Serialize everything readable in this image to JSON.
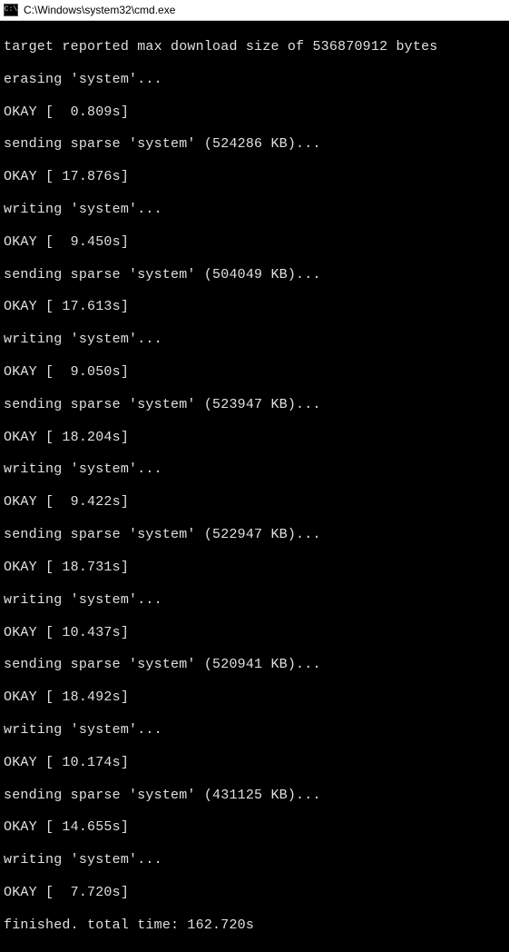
{
  "titlebar": {
    "icon_label": "C:\\",
    "path": "C:\\Windows\\system32\\cmd.exe"
  },
  "lines": [
    "target reported max download size of 536870912 bytes",
    "erasing 'system'...",
    "OKAY [  0.809s]",
    "sending sparse 'system' (524286 KB)...",
    "OKAY [ 17.876s]",
    "writing 'system'...",
    "OKAY [  9.450s]",
    "sending sparse 'system' (504049 KB)...",
    "OKAY [ 17.613s]",
    "writing 'system'...",
    "OKAY [  9.050s]",
    "sending sparse 'system' (523947 KB)...",
    "OKAY [ 18.204s]",
    "writing 'system'...",
    "OKAY [  9.422s]",
    "sending sparse 'system' (522947 KB)...",
    "OKAY [ 18.731s]",
    "writing 'system'...",
    "OKAY [ 10.437s]",
    "sending sparse 'system' (520941 KB)...",
    "OKAY [ 18.492s]",
    "writing 'system'...",
    "OKAY [ 10.174s]",
    "sending sparse 'system' (431125 KB)...",
    "OKAY [ 14.655s]",
    "writing 'system'...",
    "OKAY [  7.720s]",
    "finished. total time: 162.720s"
  ]
}
